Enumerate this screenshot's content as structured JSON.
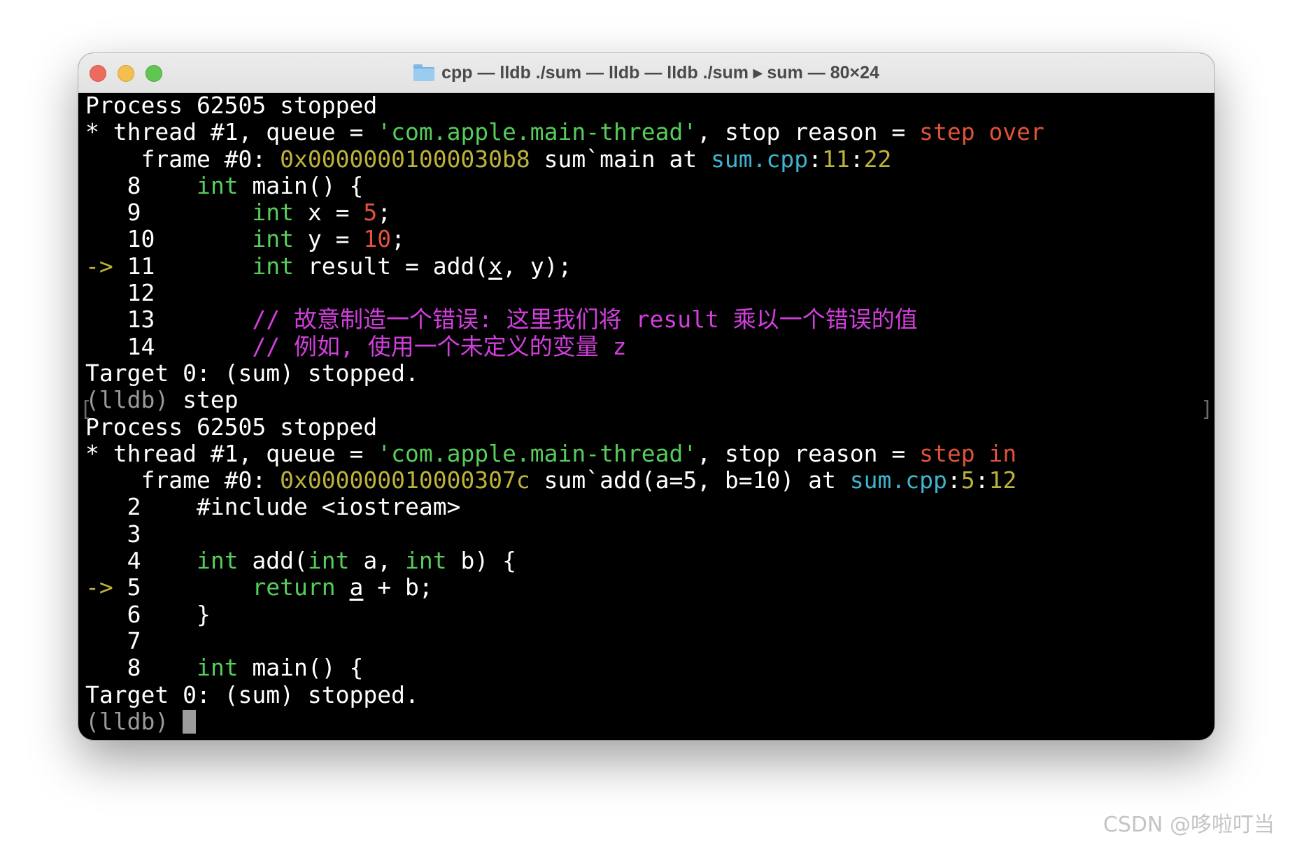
{
  "window": {
    "title": "cpp — lldb ./sum — lldb — lldb ./sum ▸ sum — 80×24"
  },
  "terminal": {
    "l01": "Process 62505 stopped",
    "l02": {
      "a": "* thread #1, queue = ",
      "b": "'com.apple.main-thread'",
      "c": ", stop reason = ",
      "d": "step over"
    },
    "l03": {
      "a": "    frame #0: ",
      "b": "0x00000001000030b8",
      "c": " sum`main at ",
      "d": "sum.cpp",
      "e": ":",
      "f": "11",
      "g": ":",
      "h": "22"
    },
    "l04": {
      "a": "   8    ",
      "b": "int",
      "c": " main() {"
    },
    "l05": {
      "a": "   9        ",
      "b": "int",
      "c": " x = ",
      "d": "5",
      "e": ";"
    },
    "l06": {
      "a": "   10       ",
      "b": "int",
      "c": " y = ",
      "d": "10",
      "e": ";"
    },
    "l07": {
      "a": "->",
      "b": " 11       ",
      "c": "int",
      "d": " result = add(",
      "e": "x",
      "f": ", y);"
    },
    "l08": "   12",
    "l09": {
      "a": "   13       ",
      "b": "// 故意制造一个错误: 这里我们将 result 乘以一个错误的值"
    },
    "l10": {
      "a": "   14       ",
      "b": "// 例如, 使用一个未定义的变量 z"
    },
    "l11": "Target 0: (sum) stopped.",
    "l12": {
      "a": "(lldb)",
      "b": " step"
    },
    "l13": "Process 62505 stopped",
    "l14": {
      "a": "* thread #1, queue = ",
      "b": "'com.apple.main-thread'",
      "c": ", stop reason = ",
      "d": "step in"
    },
    "l15": {
      "a": "    frame #0: ",
      "b": "0x000000010000307c",
      "c": " sum`add(a=5, b=10) at ",
      "d": "sum.cpp",
      "e": ":",
      "f": "5",
      "g": ":",
      "h": "12"
    },
    "l16": "   2    #include <iostream>",
    "l17": "   3",
    "l18": {
      "a": "   4    ",
      "b": "int",
      "c": " add(",
      "d": "int",
      "e": " a, ",
      "f": "int",
      "g": " b) {"
    },
    "l19": {
      "a": "->",
      "b": " 5        ",
      "c": "return",
      "d": " ",
      "e": "a",
      "f": " + b;"
    },
    "l20": "   6    }",
    "l21": "   7",
    "l22": {
      "a": "   8    ",
      "b": "int",
      "c": " main() {"
    },
    "l23": "Target 0: (sum) stopped.",
    "l24": {
      "a": "(lldb)",
      "b": " "
    }
  },
  "watermark": "CSDN @哆啦叮当",
  "colors": {
    "keyword": "#56cc5a",
    "number": "#e0533a",
    "address": "#bdb33a",
    "file": "#3eb5d0",
    "comment": "#d23fdc",
    "background": "#000000"
  }
}
